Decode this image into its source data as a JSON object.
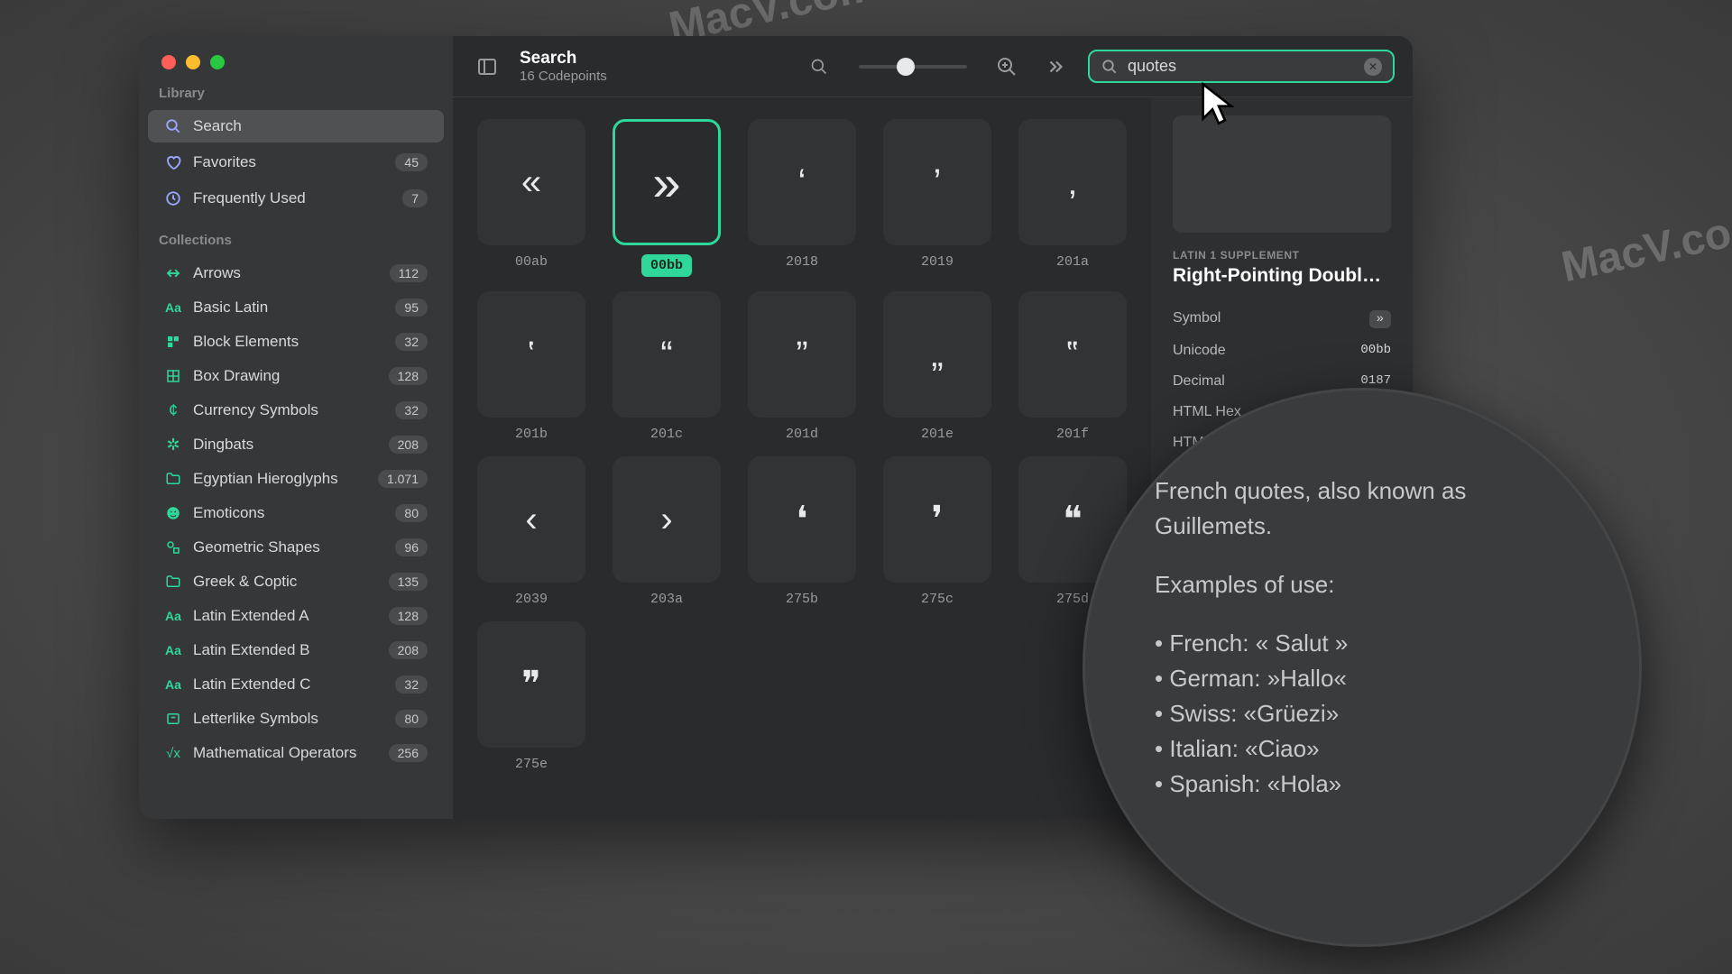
{
  "watermarks": [
    "MacV.com",
    "MacV.com",
    "MacV.co"
  ],
  "sidebar": {
    "library_header": "Library",
    "search_label": "Search",
    "favorites": {
      "label": "Favorites",
      "count": "45"
    },
    "frequent": {
      "label": "Frequently Used",
      "count": "7"
    },
    "collections_header": "Collections",
    "collections": [
      {
        "icon": "arrow",
        "color": "#2fd89a",
        "label": "Arrows",
        "count": "112"
      },
      {
        "icon": "aa",
        "color": "#2fd89a",
        "label": "Basic Latin",
        "count": "95"
      },
      {
        "icon": "block",
        "color": "#2fd89a",
        "label": "Block Elements",
        "count": "32"
      },
      {
        "icon": "box",
        "color": "#2fd89a",
        "label": "Box Drawing",
        "count": "128"
      },
      {
        "icon": "currency",
        "color": "#2fd89a",
        "label": "Currency Symbols",
        "count": "32"
      },
      {
        "icon": "sparkle",
        "color": "#2fd89a",
        "label": "Dingbats",
        "count": "208"
      },
      {
        "icon": "folder",
        "color": "#2fd89a",
        "label": "Egyptian Hieroglyphs",
        "count": "1.071"
      },
      {
        "icon": "face",
        "color": "#2fd89a",
        "label": "Emoticons",
        "count": "80"
      },
      {
        "icon": "shapes",
        "color": "#2fd89a",
        "label": "Geometric Shapes",
        "count": "96"
      },
      {
        "icon": "folder",
        "color": "#2fd89a",
        "label": "Greek & Coptic",
        "count": "135"
      },
      {
        "icon": "aa",
        "color": "#2fd89a",
        "label": "Latin Extended A",
        "count": "128"
      },
      {
        "icon": "aa",
        "color": "#2fd89a",
        "label": "Latin Extended B",
        "count": "208"
      },
      {
        "icon": "aa",
        "color": "#2fd89a",
        "label": "Latin Extended C",
        "count": "32"
      },
      {
        "icon": "letter",
        "color": "#2fd89a",
        "label": "Letterlike Symbols",
        "count": "80"
      },
      {
        "icon": "math",
        "color": "#2fd89a",
        "label": "Mathematical Operators",
        "count": "256"
      }
    ]
  },
  "header": {
    "title": "Search",
    "subtitle": "16 Codepoints",
    "search_value": "quotes"
  },
  "glyphs": [
    {
      "g": "«",
      "code": "00ab",
      "sel": false
    },
    {
      "g": "»",
      "code": "00bb",
      "sel": true
    },
    {
      "g": "‘",
      "code": "2018",
      "sel": false
    },
    {
      "g": "’",
      "code": "2019",
      "sel": false
    },
    {
      "g": "‚",
      "code": "201a",
      "sel": false
    },
    {
      "g": "‛",
      "code": "201b",
      "sel": false
    },
    {
      "g": "“",
      "code": "201c",
      "sel": false
    },
    {
      "g": "”",
      "code": "201d",
      "sel": false
    },
    {
      "g": "„",
      "code": "201e",
      "sel": false
    },
    {
      "g": "‟",
      "code": "201f",
      "sel": false
    },
    {
      "g": "‹",
      "code": "2039",
      "sel": false
    },
    {
      "g": "›",
      "code": "203a",
      "sel": false
    },
    {
      "g": "❛",
      "code": "275b",
      "sel": false
    },
    {
      "g": "❜",
      "code": "275c",
      "sel": false
    },
    {
      "g": "❝",
      "code": "275d",
      "sel": false
    },
    {
      "g": "❞",
      "code": "275e",
      "sel": false
    }
  ],
  "detail": {
    "category": "LATIN 1 SUPPLEMENT",
    "title": "Right-Pointing Double A…",
    "rows": [
      {
        "label": "Symbol",
        "value": "»",
        "chip": true
      },
      {
        "label": "Unicode",
        "value": "00bb"
      },
      {
        "label": "Decimal",
        "value": "0187"
      },
      {
        "label": "HTML Hex",
        "value": ""
      },
      {
        "label": "HTM",
        "value": ""
      }
    ],
    "description": {
      "intro": "French quotes, also known as Guillemets.",
      "examples_header": "Examples of use:",
      "examples": [
        "French: « Salut »",
        "German: »Hallo«",
        "Swiss: «Grüezi»",
        "Italian: «Ciao»",
        "Spanish: «Hola»"
      ]
    }
  }
}
